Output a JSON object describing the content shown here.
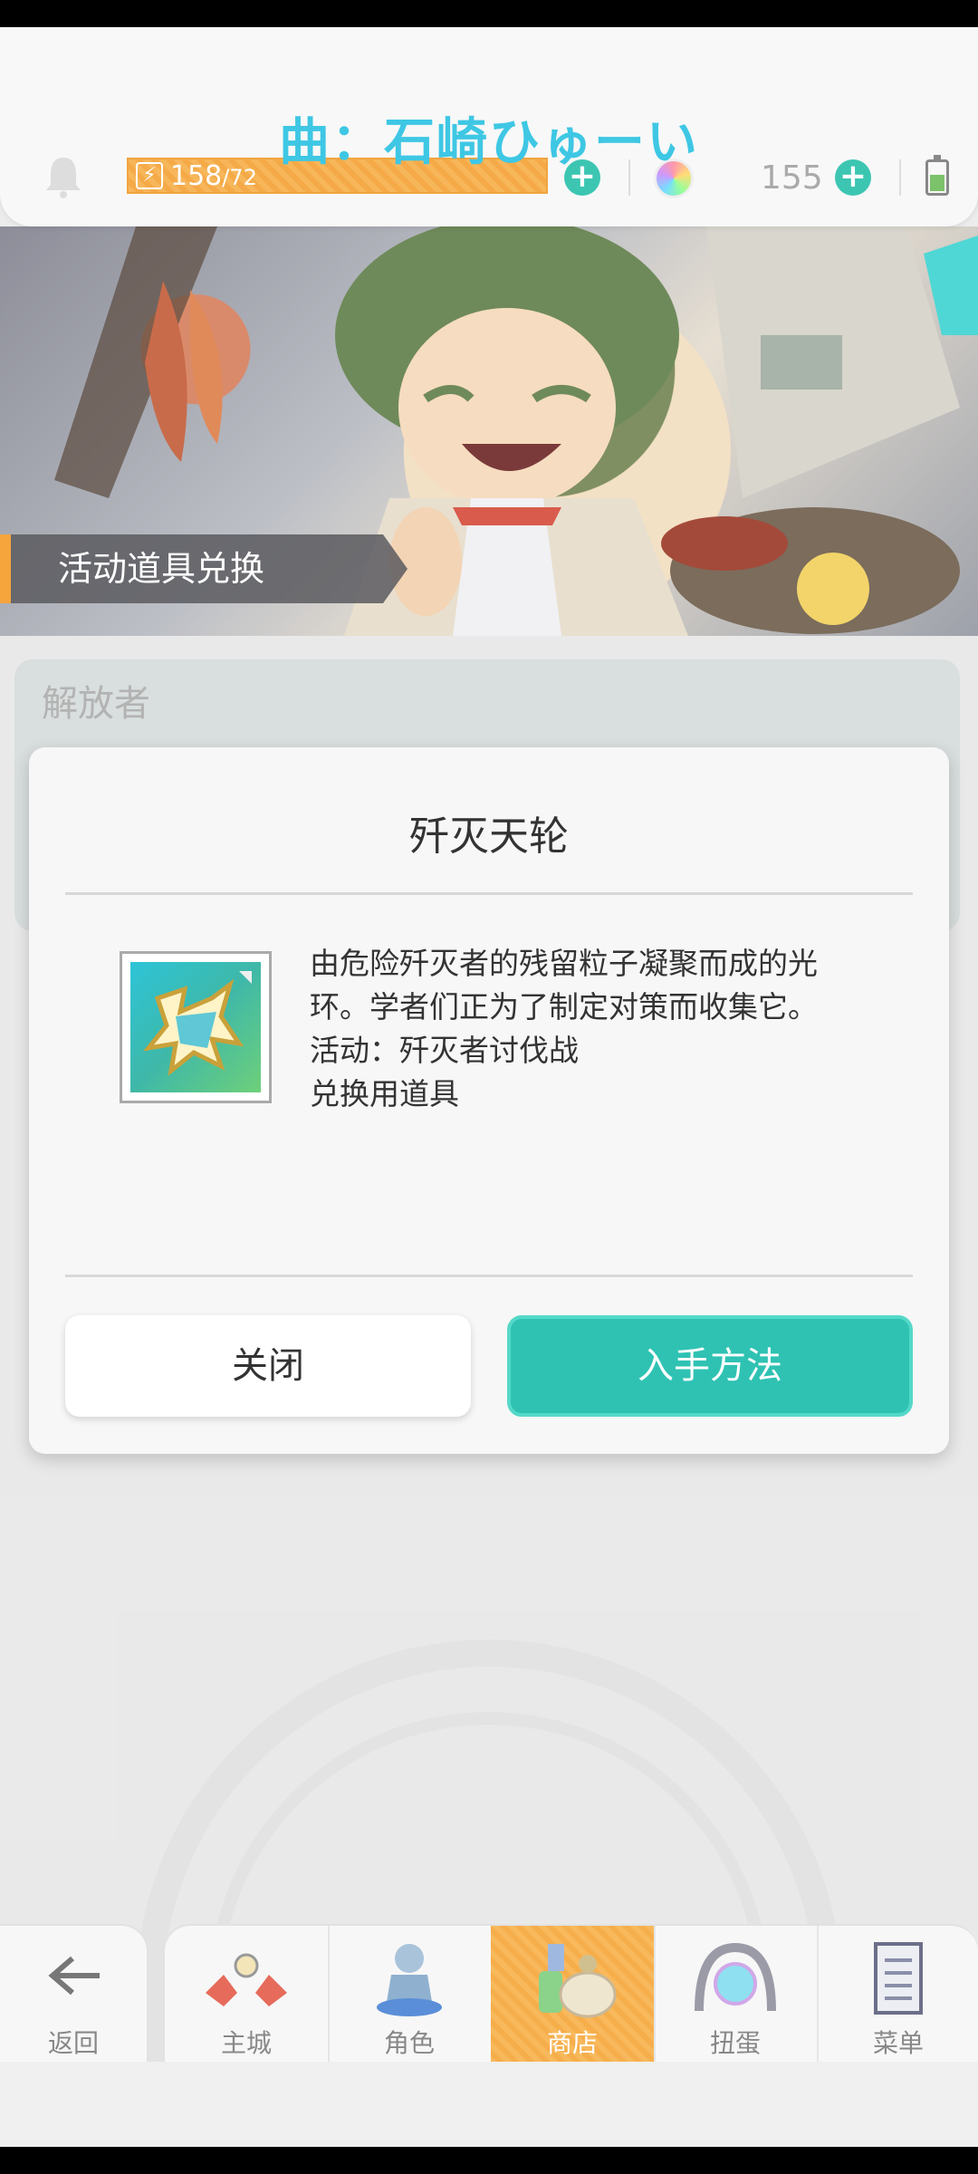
{
  "header": {
    "caption": "曲：石崎ひゅーい",
    "stamina_current": "158",
    "stamina_max": "/72",
    "gem_count": "155"
  },
  "banner": {
    "tag_label": "活动道具兑换"
  },
  "panel": {
    "title": "解放者"
  },
  "dialog": {
    "title": "歼灭天轮",
    "description_lines": [
      "由危险歼灭者的残留粒子凝聚而成的光",
      "环。学者们正为了制定对策而收集它。",
      "活动：歼灭者讨伐战",
      "兑换用道具"
    ],
    "close_label": "关闭",
    "obtain_label": "入手方法"
  },
  "nav": {
    "back_label": "返回",
    "items": [
      {
        "label": "主城",
        "icon": "town-icon"
      },
      {
        "label": "角色",
        "icon": "character-icon"
      },
      {
        "label": "商店",
        "icon": "shop-icon",
        "active": true
      },
      {
        "label": "扭蛋",
        "icon": "gacha-icon"
      },
      {
        "label": "菜单",
        "icon": "menu-icon"
      }
    ]
  },
  "colors": {
    "accent_teal": "#2fc2b3",
    "caption_blue": "#3ec7e4",
    "stamina_orange": "#f5aa47"
  }
}
